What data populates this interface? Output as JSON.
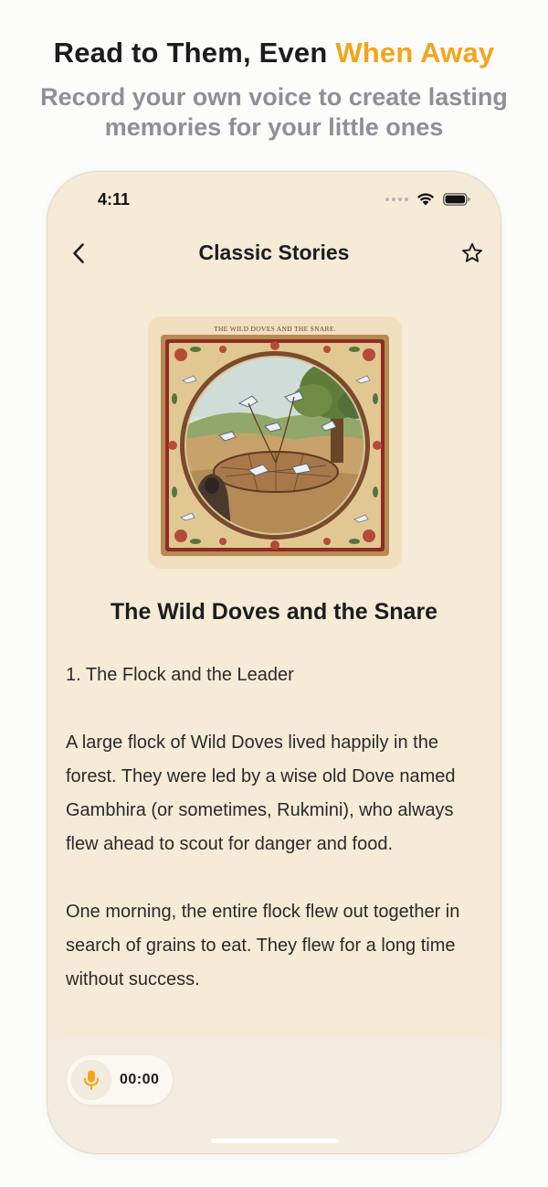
{
  "promo": {
    "headline_part1": "Read to Them, Even ",
    "headline_accent": "When Away",
    "subline": "Record your own voice to create lasting memories for your little ones",
    "accent_color": "#f5a418"
  },
  "status_bar": {
    "time": "4:11",
    "icons": [
      "cellular-signal-icon",
      "wifi-icon",
      "battery-icon"
    ]
  },
  "nav": {
    "title": "Classic Stories",
    "back_icon": "chevron-left-icon",
    "favorite_icon": "star-outline-icon"
  },
  "story": {
    "cover_caption": "THE WILD DOVES AND THE SNARE.",
    "title": "The Wild Doves and the Snare",
    "paragraphs": [
      "1. The Flock and the Leader",
      "A large flock of Wild Doves lived happily in the forest. They were led by a wise old Dove named Gambhira (or sometimes, Rukmini), who always flew ahead to scout for danger and food.",
      "One morning, the entire flock flew out together in search of grains to eat. They flew for a long time without success."
    ]
  },
  "recorder": {
    "mic_icon": "microphone-icon",
    "timer": "00:00"
  }
}
